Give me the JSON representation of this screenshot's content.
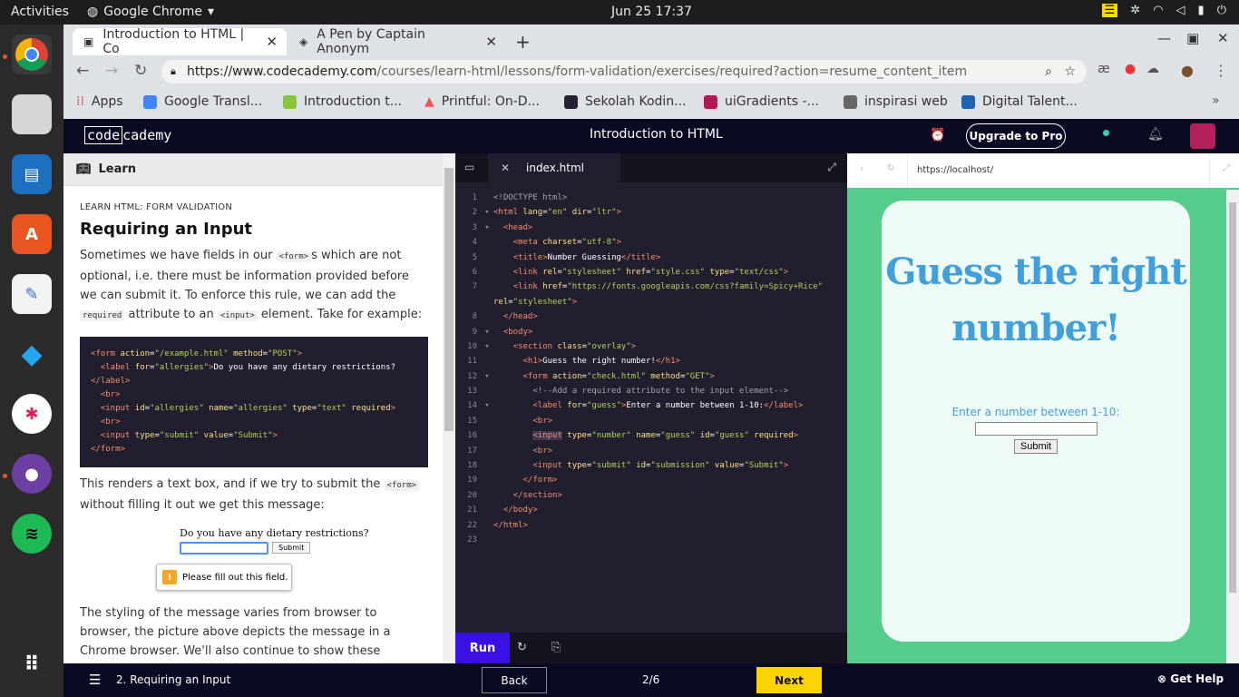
{
  "os": {
    "activities": "Activities",
    "app_name": "Google Chrome",
    "clock": "Jun 25  17:37"
  },
  "browser": {
    "tabs": [
      {
        "label": "Introduction to HTML | Co",
        "active": true
      },
      {
        "label": "A Pen by Captain Anonym",
        "active": false
      }
    ],
    "url_domain": "https://www.codecademy.com",
    "url_path": "/courses/learn-html/lessons/form-validation/exercises/required?action=resume_content_item",
    "bookmarks": [
      "Apps",
      "Google Transl...",
      "Introduction t...",
      "Printful: On-D...",
      "Sekolah Kodin...",
      "uiGradients -...",
      "inspirasi web",
      "Digital Talent..."
    ]
  },
  "codecademy": {
    "logo_code": "code",
    "logo_rest": "cademy",
    "course_title": "Introduction to HTML",
    "upgrade_label": "Upgrade to Pro"
  },
  "learn": {
    "header": "Learn",
    "kicker": "LEARN HTML: FORM VALIDATION",
    "title": "Requiring an Input",
    "p1_a": "Sometimes we have fields in our ",
    "p1_code1": "<form>",
    "p1_b": "s which are not optional, i.e. there must be information provided before we can submit it. To enforce this rule, we can add the ",
    "p1_code2": "required",
    "p1_c": " attribute to an ",
    "p1_code3": "<input>",
    "p1_d": " element. Take for example:",
    "p2_a": "This renders a text box, and if we try to submit the ",
    "p2_code": "<form>",
    "p2_b": " without filling it out we get this message:",
    "demo_label": "Do you have any dietary restrictions?",
    "demo_submit": "Submit",
    "demo_tooltip": "Please fill out this field.",
    "p3": "The styling of the message varies from browser to browser, the picture above depicts the message in a Chrome browser. We'll also continue to show these messages as they appear in Chrome"
  },
  "editor": {
    "tab_name": "index.html",
    "run_label": "Run",
    "line_numbers": [
      "1",
      "2",
      "3",
      "4",
      "5",
      "6",
      "7",
      "8",
      "9",
      "10",
      "11",
      "12",
      "13",
      "14",
      "15",
      "16",
      "17",
      "18",
      "19",
      "20",
      "21",
      "22",
      "23"
    ]
  },
  "preview": {
    "url": "https://localhost/",
    "heading": "Guess the right number!",
    "label": "Enter a number between 1-10:",
    "submit": "Submit"
  },
  "footer": {
    "lesson": "2. Requiring an Input",
    "back": "Back",
    "progress": "2/6",
    "next": "Next",
    "help": "Get Help"
  }
}
